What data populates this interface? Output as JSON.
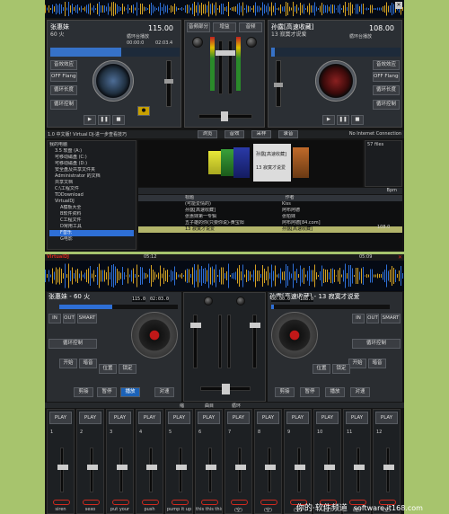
{
  "top_screen": {
    "deck_left": {
      "title": "张惠妹",
      "subtitle": "60 火",
      "bpm": "115.00",
      "pitch_label": "循环台播放",
      "elapsed": "00:00:0",
      "remain": "02:03.4"
    },
    "deck_right": {
      "title": "孙露[高速收藏]",
      "subtitle": "13 寂寞才说爱",
      "bpm": "108.00",
      "pitch_label": "循环台播放"
    },
    "deck_left_buttons": [
      "音效效应",
      "OFF Flanger",
      "循环长度",
      "循环控制"
    ],
    "deck_right_buttons": [
      "音效效应",
      "OFF Flanger",
      "循环长度",
      "循环控制"
    ],
    "mixer_buttons": [
      "音频部分",
      "增益",
      "音频"
    ],
    "status_bar": {
      "left": "1.0 中文版! Virtual DJ-进一步查看技巧",
      "tabs": [
        "浏览",
        "音效",
        "采样",
        "录音"
      ],
      "right": "No Internet Connection"
    },
    "browser": {
      "tree": [
        "我的电脑",
        "3.5 软盘 (A:)",
        "可移动磁盘 (C:)",
        "可移动磁盘 (D:)",
        "安全盘及共享文件夹",
        "Administrator 的文档",
        "共享文档",
        "C:\\工程文件",
        "TDDownload",
        "VirtualDJ",
        "A模板大全",
        "B软件资料",
        "C工程文件",
        "D常用工具",
        "F音乐",
        "G电影"
      ],
      "columns": [
        "标题",
        "作者"
      ],
      "rows": [
        {
          "title": "(可能爱情的)",
          "artist": "Kiss"
        },
        {
          "title": "孙露[高速收藏]",
          "artist": "阿布阿德"
        },
        {
          "title": "张惠妹第一专辑",
          "artist": "张柏妹"
        },
        {
          "title": "五子雄的你(只要你说)-黄宝阳",
          "artist": "阿布阿德[84.com]"
        },
        {
          "title": "13 寂寞才说爱",
          "artist": "孙露[高速收藏]"
        }
      ],
      "side_list": "57 files",
      "side_input": "Bpm",
      "cover_caption_1": "孙露[高速收藏]",
      "cover_caption_2": "13 寂寞才说爱",
      "bpm_value": "108.0"
    }
  },
  "bottom_screen": {
    "header": {
      "brand": "VirtualDJ",
      "time_left": "05:12",
      "time_right": "05:09"
    },
    "deck_left": {
      "title": "张惠妹 - 60 火",
      "elapsed_label": "ELAPSED",
      "bpm_label": "BPM",
      "elapsed": "02:03.0",
      "bpm": "115.0"
    },
    "deck_right": {
      "title": "孙露[高速收藏] - 13 寂寞才说爱",
      "elapsed_label": "ELAPSED",
      "bpm_label": "BPM",
      "elapsed": "00:00.0",
      "bpm": "108.0"
    },
    "left_buttons": {
      "in": "IN",
      "out": "OUT",
      "smart": "SMART",
      "loop_row": "循环控制",
      "start": "开始",
      "cue": "暗音",
      "pos": "位置",
      "lock": "锁定",
      "play": "剪接",
      "stop": "暂停",
      "play_active": "播放",
      "sync": "对速"
    },
    "right_buttons": {
      "in": "IN",
      "out": "OUT",
      "smart": "SMART",
      "loop_row": "循环控制",
      "start": "开始",
      "cue": "暗音",
      "pos": "位置",
      "lock": "锁定",
      "play": "剪接",
      "stop": "暂停",
      "play_active": "播放",
      "sync": "对速"
    },
    "tab_bar": [
      "缩",
      "曲目",
      "循环"
    ],
    "sampler": {
      "slots": [
        "1",
        "2",
        "3",
        "4",
        "5",
        "6",
        "7",
        "8",
        "9",
        "10",
        "11",
        "12"
      ],
      "play_label": "PLAY",
      "names": [
        "siren",
        "sexo",
        "put your",
        "push",
        "pump it up",
        "this this this",
        "(空)",
        "(空)",
        "(空)",
        "(空)",
        "(空)",
        "(空)"
      ]
    }
  },
  "watermark": {
    "brand": "你的·软件频道",
    "site": "software.it168.com"
  },
  "colors": {
    "background": "#a7c46d",
    "frame": "#141414",
    "wave_blue": "#2e6fd6",
    "wave_gold": "#d3a223",
    "active_blue": "#1b62b8",
    "red": "#d12a1f"
  }
}
